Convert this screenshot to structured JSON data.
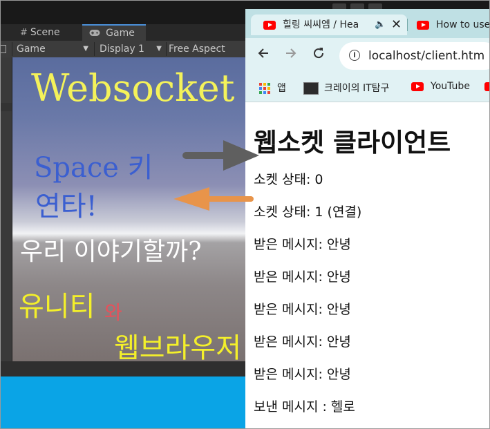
{
  "unity": {
    "tabs": [
      {
        "label": "Scene",
        "icon": "grid-icon"
      },
      {
        "label": "Game",
        "icon": "gamepad-icon"
      }
    ],
    "game_options": {
      "view": "Game",
      "display": "Display 1",
      "aspect": "Free Aspect"
    },
    "game_view": {
      "title": "Websocket",
      "line1": "Space 키",
      "line2": "연타!",
      "line3": "우리 이야기할까?",
      "unity_text": "유니티",
      "wa_text": "와",
      "browser_text": "웹브라우저"
    }
  },
  "browser": {
    "tabs": [
      {
        "title": "힐링 씨씨엠 / Hea",
        "icon": "youtube-icon"
      },
      {
        "title": "How to use",
        "icon": "youtube-icon"
      }
    ],
    "url": "localhost/client.htm",
    "bookmarks": [
      {
        "label": "앱",
        "icon": "apps-grid-icon"
      },
      {
        "label": "크레이의 IT탐구",
        "icon": "blog-favicon-icon"
      },
      {
        "label": "YouTube",
        "icon": "youtube-icon"
      }
    ]
  },
  "page": {
    "heading": "웹소켓 클라이언트",
    "lines": [
      "소켓 상태: 0",
      "소켓 상태: 1 (연결)",
      "받은 메시지: 안녕",
      "받은 메시지: 안녕",
      "받은 메시지: 안녕",
      "받은 메시지: 안녕",
      "받은 메시지: 안녕",
      "보낸 메시지 : 헬로"
    ]
  },
  "colors": {
    "arrow_right": "#5f5f5f",
    "arrow_left": "#e8944a",
    "title_yellow": "#f4f25a",
    "space_blue": "#3b5fd0",
    "wa_red": "#e8505a"
  }
}
